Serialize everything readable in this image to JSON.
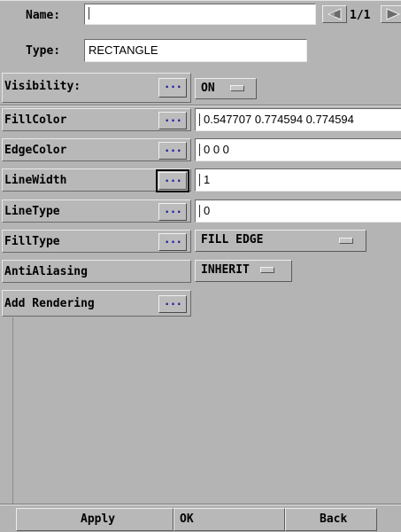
{
  "header": {
    "name_label": "Name:",
    "name_value": "",
    "type_label": "Type:",
    "type_value": "RECTANGLE",
    "page_indicator": "1/1",
    "prev_icon": "triangle-left-icon",
    "next_icon": "triangle-right-icon"
  },
  "visibility": {
    "label": "Visibility:",
    "dots": "...",
    "value": "ON"
  },
  "properties": [
    {
      "label": "FillColor",
      "dots": "...",
      "value": "0.547707 0.774594 0.774594",
      "kind": "text"
    },
    {
      "label": "EdgeColor",
      "dots": "...",
      "value": "0 0 0",
      "kind": "text"
    },
    {
      "label": "LineWidth",
      "dots": "...",
      "value": "1",
      "kind": "text"
    },
    {
      "label": "LineType",
      "dots": "...",
      "value": "0",
      "kind": "text"
    },
    {
      "label": "FillType",
      "dots": "...",
      "value": "FILL EDGE",
      "kind": "menu"
    },
    {
      "label": "AntiAliasing",
      "value": "INHERIT",
      "kind": "menu"
    },
    {
      "label": "Add Rendering",
      "dots": "..."
    }
  ],
  "footer": {
    "apply": "Apply",
    "ok": "OK",
    "back": "Back"
  }
}
